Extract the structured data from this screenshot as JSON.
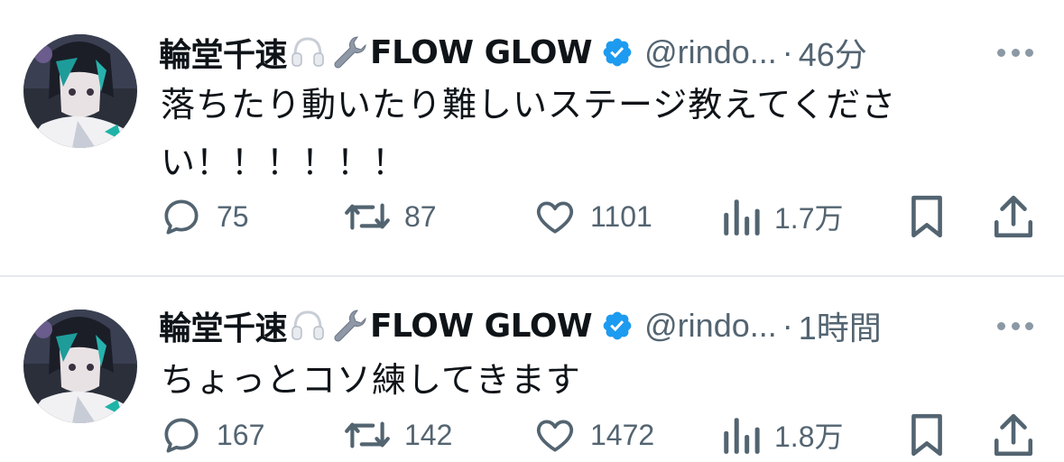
{
  "colors": {
    "text_primary": "#0f1419",
    "text_secondary": "#536471",
    "verified_blue": "#1d9bf0",
    "divider": "#e6e9ec"
  },
  "tweets": [
    {
      "display_name_prefix": "輪堂千速",
      "display_name_suffix": "FLOW GLOW",
      "name_emojis": [
        "headphones-emoji",
        "wrench-emoji"
      ],
      "verified": true,
      "handle": "@rindo...",
      "separator": "·",
      "time": "46分",
      "text": "落ちたり動いたり難しいステージ教えてくださ\nい！！！！！！",
      "counts": {
        "replies": "75",
        "retweets": "87",
        "likes": "1101",
        "views": "1.7万"
      }
    },
    {
      "display_name_prefix": "輪堂千速",
      "display_name_suffix": "FLOW GLOW",
      "name_emojis": [
        "headphones-emoji",
        "wrench-emoji"
      ],
      "verified": true,
      "handle": "@rindo...",
      "separator": "·",
      "time": "1時間",
      "text": "ちょっとコソ練してきます",
      "counts": {
        "replies": "167",
        "retweets": "142",
        "likes": "1472",
        "views": "1.8万"
      }
    }
  ]
}
